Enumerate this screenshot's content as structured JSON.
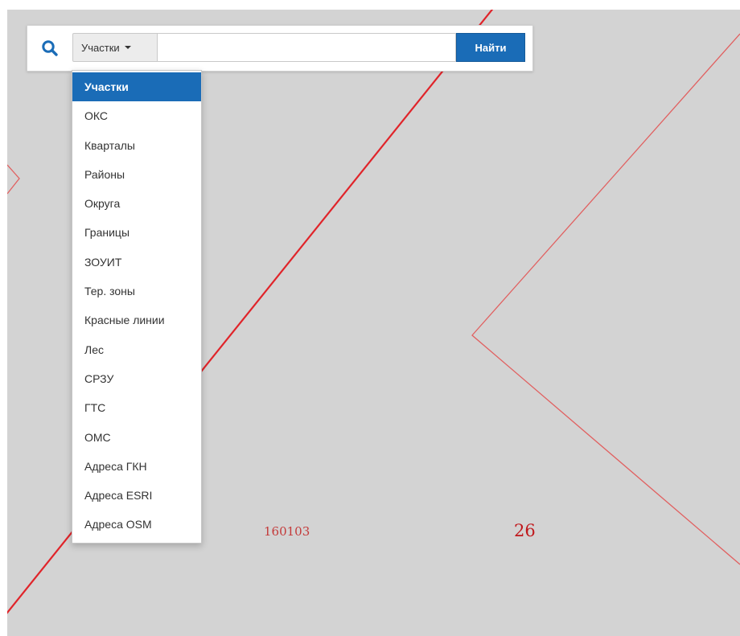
{
  "search": {
    "icon": "search-icon",
    "selected_type": "Участки",
    "input_value": "",
    "placeholder": "",
    "button_label": "Найти"
  },
  "dropdown": {
    "items": [
      "Участки",
      "ОКС",
      "Кварталы",
      "Районы",
      "Округа",
      "Границы",
      "ЗОУИТ",
      "Тер. зоны",
      "Красные линии",
      "Лес",
      "СРЗУ",
      "ГТС",
      "ОМС",
      "Адреса ГКН",
      "Адреса ESRI",
      "Адреса OSM"
    ],
    "active_index": 0
  },
  "map": {
    "labels": [
      "160103",
      "26"
    ],
    "colors": {
      "background": "#d3d3d3",
      "boundary": "#e0242a",
      "label": "#c0181c"
    }
  },
  "colors": {
    "accent": "#1a6cb7"
  }
}
